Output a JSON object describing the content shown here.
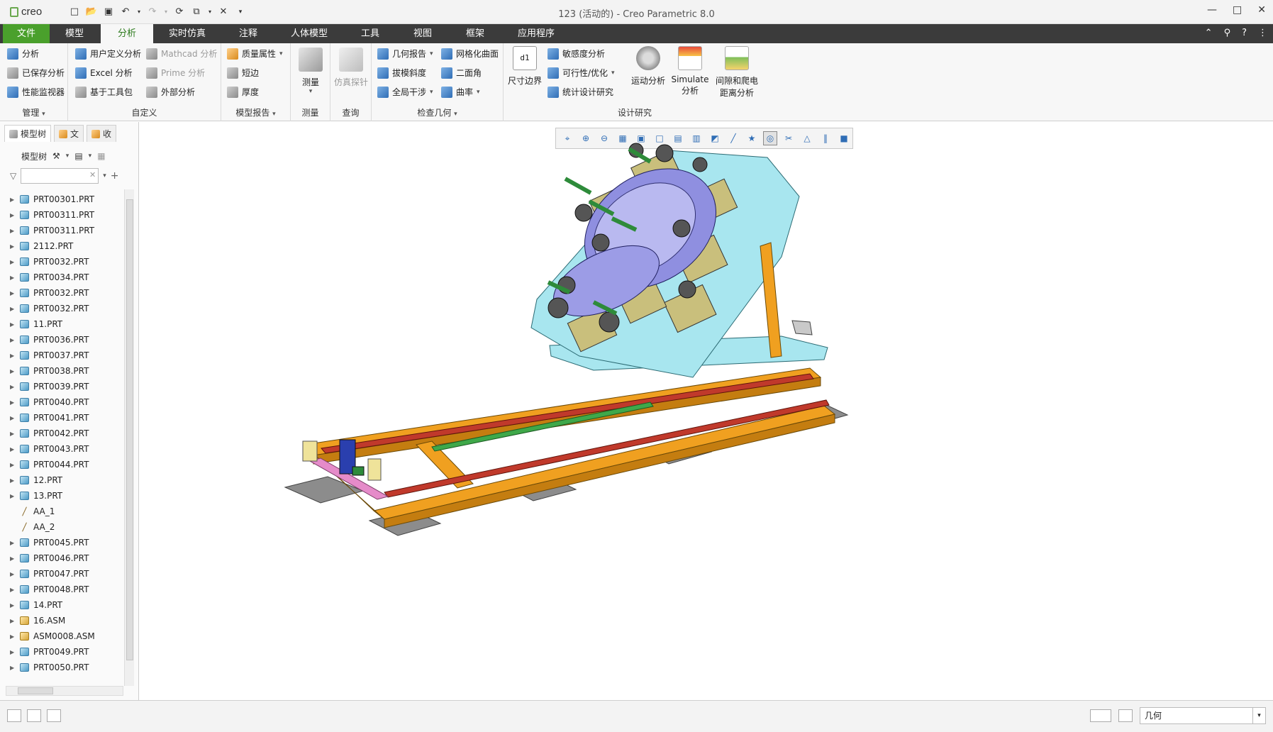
{
  "app": {
    "logo_text": "creo",
    "window_title": "123 (活动的) - Creo Parametric 8.0"
  },
  "ribbon_tabs": [
    "文件",
    "模型",
    "分析",
    "实时仿真",
    "注释",
    "人体模型",
    "工具",
    "视图",
    "框架",
    "应用程序"
  ],
  "ribbon_active_tab": "分析",
  "ribbon": {
    "manage": {
      "group_label": "管理",
      "items": [
        "分析",
        "已保存分析",
        "性能监视器"
      ]
    },
    "custom": {
      "group_label": "自定义",
      "items": [
        "用户定义分析",
        "Excel 分析",
        "基于工具包"
      ],
      "dim_items": [
        "Mathcad 分析",
        "Prime 分析"
      ],
      "external": "外部分析"
    },
    "model_report": {
      "group_label": "模型报告",
      "items": [
        "质量属性",
        "短边",
        "厚度"
      ]
    },
    "measure": {
      "group_label": "测量",
      "big_label": "测量"
    },
    "query": {
      "group_label": "查询",
      "big_label": "仿真探针"
    },
    "inspect_geometry": {
      "group_label": "检查几何",
      "col1": [
        "几何报告",
        "拔模斜度",
        "全局干涉"
      ],
      "col2": [
        "网格化曲面",
        "二面角",
        "曲率"
      ]
    },
    "design_study": {
      "group_label": "设计研究",
      "dim_boundary": "尺寸边界",
      "items": [
        "敏感度分析",
        "可行性/优化",
        "统计设计研究"
      ],
      "big": [
        "运动分析",
        "Simulate 分析",
        "间隙和爬电距离分析"
      ],
      "big_lines": {
        "simulate_1": "Simulate",
        "simulate_2": "分析",
        "clearance_1": "间隙和爬电",
        "clearance_2": "距离分析"
      }
    }
  },
  "left_panel": {
    "tabs": [
      "模型树",
      "文",
      "收"
    ],
    "tree_label": "模型树",
    "search_placeholder": "",
    "tree_items": [
      {
        "label": "PRT00301.PRT",
        "type": "part"
      },
      {
        "label": "PRT00311.PRT",
        "type": "part"
      },
      {
        "label": "PRT00311.PRT",
        "type": "part"
      },
      {
        "label": "2112.PRT",
        "type": "part"
      },
      {
        "label": "PRT0032.PRT",
        "type": "part"
      },
      {
        "label": "PRT0034.PRT",
        "type": "part"
      },
      {
        "label": "PRT0032.PRT",
        "type": "part"
      },
      {
        "label": "PRT0032.PRT",
        "type": "part"
      },
      {
        "label": "11.PRT",
        "type": "part"
      },
      {
        "label": "PRT0036.PRT",
        "type": "part"
      },
      {
        "label": "PRT0037.PRT",
        "type": "part"
      },
      {
        "label": "PRT0038.PRT",
        "type": "part"
      },
      {
        "label": "PRT0039.PRT",
        "type": "part"
      },
      {
        "label": "PRT0040.PRT",
        "type": "part"
      },
      {
        "label": "PRT0041.PRT",
        "type": "part"
      },
      {
        "label": "PRT0042.PRT",
        "type": "part"
      },
      {
        "label": "PRT0043.PRT",
        "type": "part"
      },
      {
        "label": "PRT0044.PRT",
        "type": "part"
      },
      {
        "label": "12.PRT",
        "type": "part"
      },
      {
        "label": "13.PRT",
        "type": "part"
      },
      {
        "label": "AA_1",
        "type": "axis"
      },
      {
        "label": "AA_2",
        "type": "axis"
      },
      {
        "label": "PRT0045.PRT",
        "type": "part"
      },
      {
        "label": "PRT0046.PRT",
        "type": "part"
      },
      {
        "label": "PRT0047.PRT",
        "type": "part"
      },
      {
        "label": "PRT0048.PRT",
        "type": "part"
      },
      {
        "label": "14.PRT",
        "type": "part"
      },
      {
        "label": "16.ASM",
        "type": "asm"
      },
      {
        "label": "ASM0008.ASM",
        "type": "asm"
      },
      {
        "label": "PRT0049.PRT",
        "type": "part"
      },
      {
        "label": "PRT0050.PRT",
        "type": "part"
      }
    ]
  },
  "view_toolbar_icons": [
    "refit-icon",
    "zoom-in-icon",
    "zoom-out-icon",
    "repaint-icon",
    "display-style-icon",
    "saved-orientations-icon",
    "view-manager-icon",
    "perspective-icon",
    "section-icon",
    "datum-display-icon",
    "annotation-display-icon",
    "spin-center-icon",
    "cut-icon",
    "warning-icon",
    "pause-icon",
    "stop-icon"
  ],
  "status_bar": {
    "selection_filter": "几何"
  },
  "colors": {
    "file_tab": "#4aa02c",
    "tab_bar": "#3b3b3b",
    "frame_orange": "#f0a020",
    "rail_red": "#c0392b",
    "fixture_cyan": "#a8e6ef",
    "foot_gray": "#8c8c8c"
  }
}
